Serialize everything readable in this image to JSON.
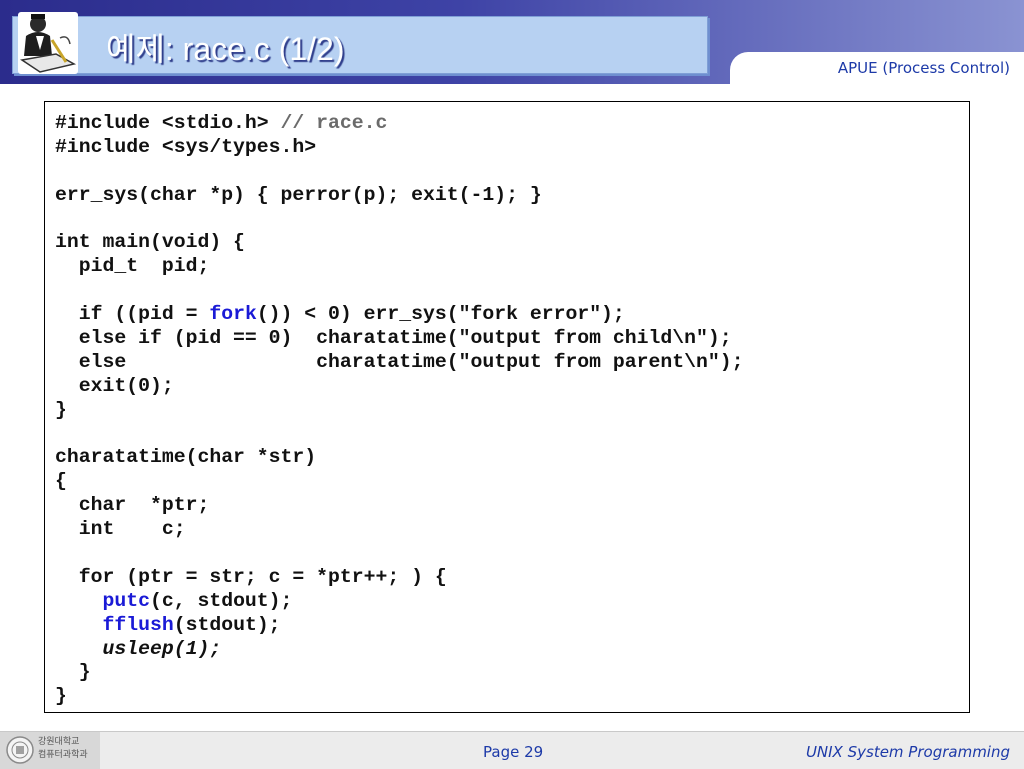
{
  "header": {
    "title": "예제: race.c (1/2)",
    "subtitle": "APUE (Process Control)",
    "logo_icon": "person-writing-icon"
  },
  "code": {
    "lines": [
      [
        {
          "t": "#include <stdio.h> "
        },
        {
          "t": "// race.c",
          "c": "cm"
        }
      ],
      [
        {
          "t": "#include <sys/types.h>"
        }
      ],
      [
        {
          "t": ""
        }
      ],
      [
        {
          "t": "err_sys(char *p) { perror(p); exit(-1); }"
        }
      ],
      [
        {
          "t": ""
        }
      ],
      [
        {
          "t": "int main(void) {"
        }
      ],
      [
        {
          "t": "  pid_t  pid;"
        }
      ],
      [
        {
          "t": ""
        }
      ],
      [
        {
          "t": "  if ((pid = "
        },
        {
          "t": "fork",
          "c": "kw"
        },
        {
          "t": "()) < 0) err_sys(\"fork error\");"
        }
      ],
      [
        {
          "t": "  else if (pid == 0)  charatatime(\"output from child\\n\");"
        }
      ],
      [
        {
          "t": "  else                charatatime(\"output from parent\\n\");"
        }
      ],
      [
        {
          "t": "  exit(0);"
        }
      ],
      [
        {
          "t": "}"
        }
      ],
      [
        {
          "t": ""
        }
      ],
      [
        {
          "t": "charatatime(char *str)"
        }
      ],
      [
        {
          "t": "{"
        }
      ],
      [
        {
          "t": "  char  *ptr;"
        }
      ],
      [
        {
          "t": "  int    c;"
        }
      ],
      [
        {
          "t": ""
        }
      ],
      [
        {
          "t": "  for (ptr = str; c = *ptr++; ) {"
        }
      ],
      [
        {
          "t": "    "
        },
        {
          "t": "putc",
          "c": "kw"
        },
        {
          "t": "(c, stdout);"
        }
      ],
      [
        {
          "t": "    "
        },
        {
          "t": "fflush",
          "c": "kw"
        },
        {
          "t": "(stdout);"
        }
      ],
      [
        {
          "t": "    "
        },
        {
          "t": "usleep(1);",
          "c": "it"
        }
      ],
      [
        {
          "t": "  }"
        }
      ],
      [
        {
          "t": "}"
        }
      ]
    ]
  },
  "footer": {
    "school_line1": "강원대학교",
    "school_line2": "컴퓨터과학과",
    "seal_icon": "university-seal-icon",
    "page": "Page 29",
    "course": "UNIX System Programming"
  },
  "colors": {
    "header_dark": "#2b2c8c",
    "title_box": "#b7d1f2",
    "accent_blue": "#1d3aa8",
    "keyword_blue": "#1a1ad6",
    "comment_gray": "#6b6b6b"
  }
}
